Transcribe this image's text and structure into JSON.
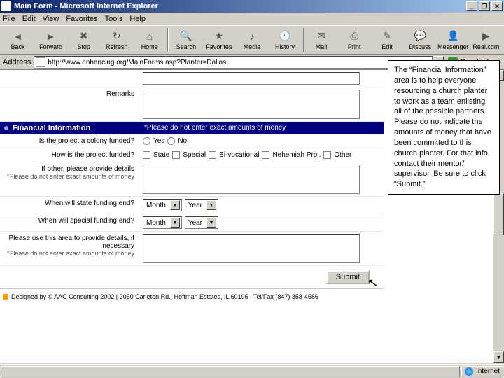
{
  "window": {
    "title": "Main Form - Microsoft Internet Explorer"
  },
  "menu": {
    "file": "File",
    "edit": "Edit",
    "view": "View",
    "favorites": "Favorites",
    "tools": "Tools",
    "help": "Help"
  },
  "toolbar": {
    "back": "Back",
    "forward": "Forward",
    "stop": "Stop",
    "refresh": "Refresh",
    "home": "Home",
    "search": "Search",
    "favorites": "Favorites",
    "media": "Media",
    "history": "History",
    "mail": "Mail",
    "print": "Print",
    "edit": "Edit",
    "discuss": "Discuss",
    "messenger": "Messenger",
    "realcom": "Real.com"
  },
  "address": {
    "label": "Address",
    "url": "http://www.enhancing.org/MainForms.asp?Planter=Dallas",
    "go": "Go",
    "links": "Links",
    "chevron": "»"
  },
  "form": {
    "remarks_label": "Remarks",
    "section_title": "Financial Information",
    "section_warning": "*Please do not enter exact amounts of money",
    "q_colony": "Is the project a colony funded?",
    "q_colony_yes": "Yes",
    "q_colony_no": "No",
    "q_funded": "How is the project funded?",
    "chk_state": "State",
    "chk_special": "Special",
    "chk_bivoc": "Bi-vocational",
    "chk_nehemiah": "Nehemiah Proj.",
    "chk_other": "Other",
    "q_other_details": "If other, please provide details",
    "note_money": "*Please do not enter exact amounts of money",
    "q_state_end": "When will state funding end?",
    "q_special_end": "When will special funding end?",
    "month": "Month",
    "year": "Year",
    "q_details": "Please use this area to provide details, if necessary",
    "note_money2": "*Please do not enter exact amounts of money",
    "submit": "Submit"
  },
  "footer": {
    "text": "Designed by © AAC Consulting 2002 | 2050 Carleton Rd., Hoffman Estates, IL 60195 | Tel/Fax (847) 358-4586"
  },
  "status": {
    "zone": "Internet"
  },
  "help": {
    "text": "The “Financial Information” area is to help everyone resourcing a church planter to work as a team enlisting all of the possible partners. Please do not indicate the amounts of money that have been committed to this church planter. For that info, contact their mentor/ supervisor. Be sure to click “Submit.”"
  }
}
